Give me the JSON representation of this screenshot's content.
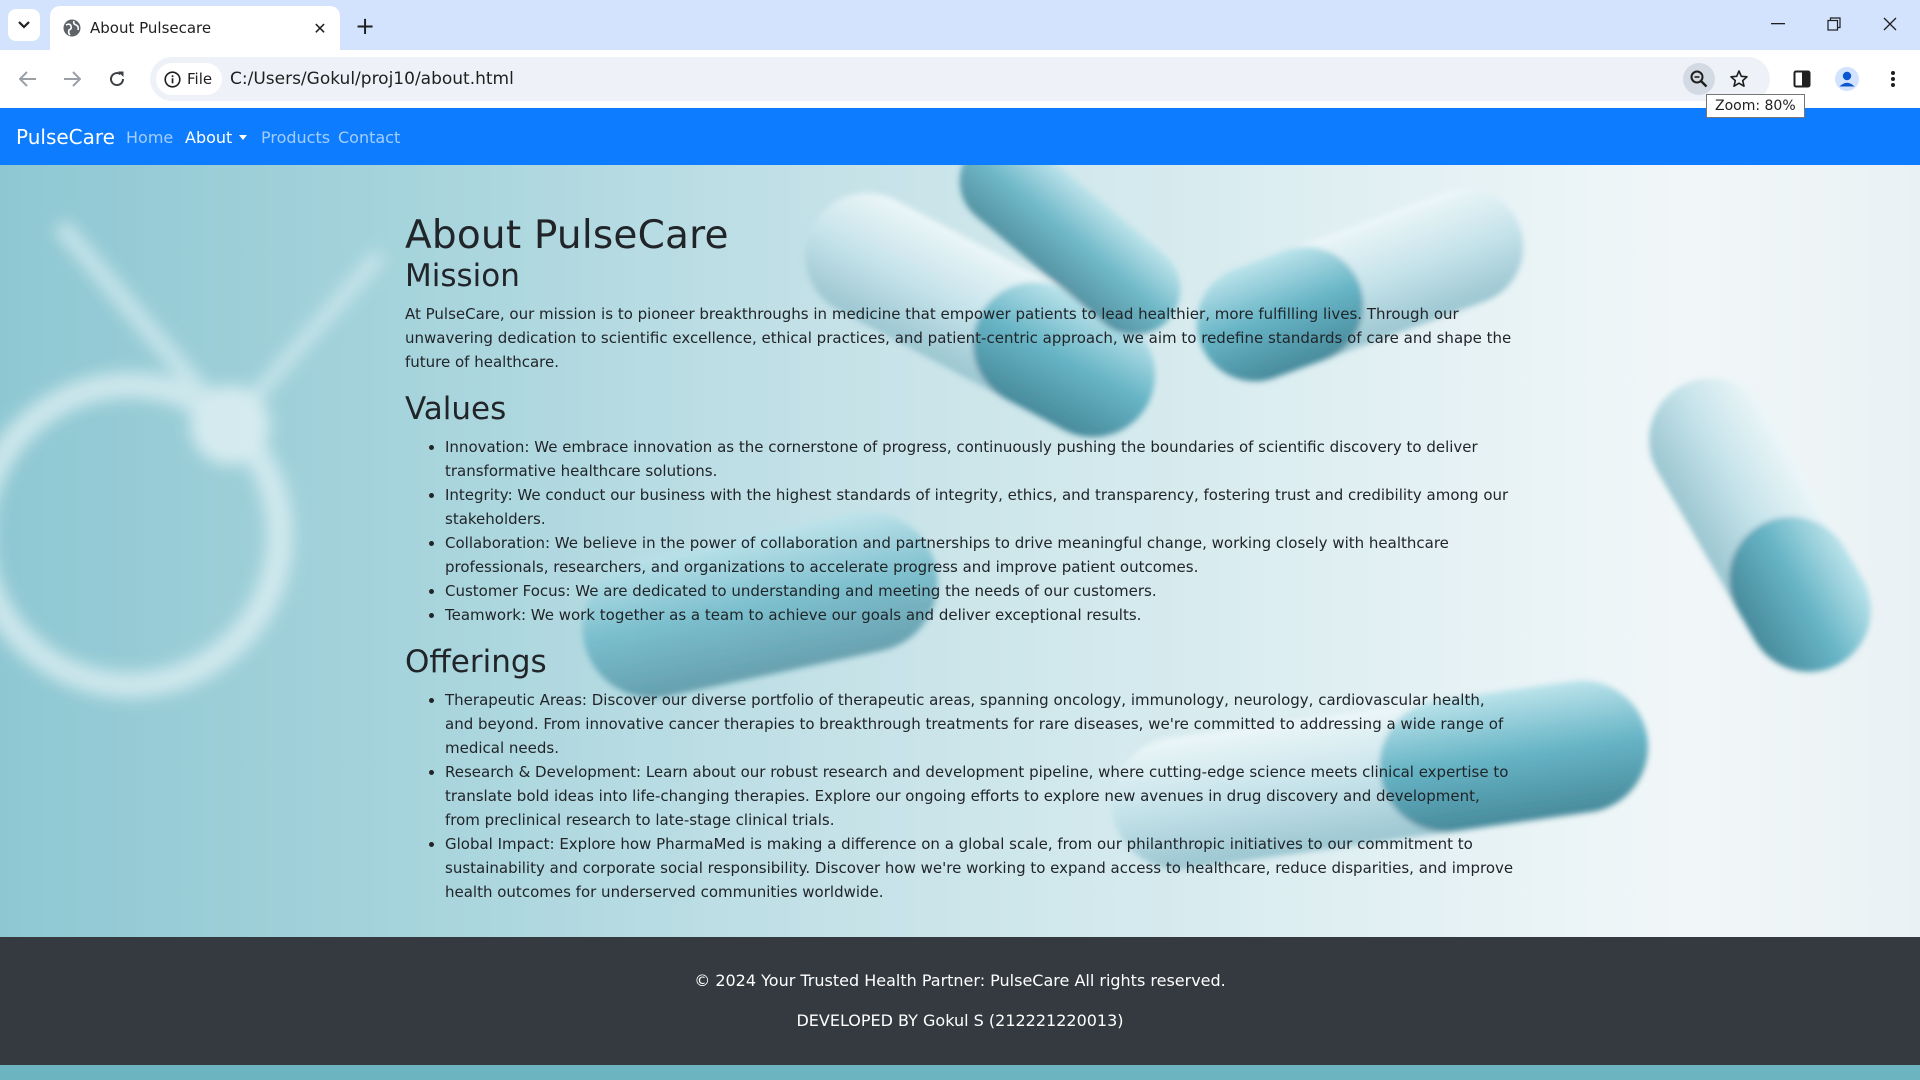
{
  "browser": {
    "tab_title": "About Pulsecare",
    "url_chip": "File",
    "url": "C:/Users/Gokul/proj10/about.html",
    "zoom_tooltip": "Zoom: 80%"
  },
  "navbar": {
    "brand": "PulseCare",
    "links": [
      {
        "label": "Home",
        "active": false
      },
      {
        "label": "About",
        "active": true,
        "dropdown": true
      },
      {
        "label": "Products",
        "active": false
      },
      {
        "label": "Contact",
        "active": false
      }
    ],
    "color": "#0d7cff"
  },
  "main": {
    "title": "About PulseCare",
    "mission": {
      "heading": "Mission",
      "text": "At PulseCare, our mission is to pioneer breakthroughs in medicine that empower patients to lead healthier, more fulfilling lives. Through our unwavering dedication to scientific excellence, ethical practices, and patient-centric approach, we aim to redefine standards of care and shape the future of healthcare."
    },
    "values": {
      "heading": "Values",
      "items": [
        "Innovation: We embrace innovation as the cornerstone of progress, continuously pushing the boundaries of scientific discovery to deliver transformative healthcare solutions.",
        "Integrity: We conduct our business with the highest standards of integrity, ethics, and transparency, fostering trust and credibility among our stakeholders.",
        "Collaboration: We believe in the power of collaboration and partnerships to drive meaningful change, working closely with healthcare professionals, researchers, and organizations to accelerate progress and improve patient outcomes.",
        "Customer Focus: We are dedicated to understanding and meeting the needs of our customers.",
        "Teamwork: We work together as a team to achieve our goals and deliver exceptional results."
      ]
    },
    "offerings": {
      "heading": "Offerings",
      "items": [
        "Therapeutic Areas: Discover our diverse portfolio of therapeutic areas, spanning oncology, immunology, neurology, cardiovascular health, and beyond. From innovative cancer therapies to breakthrough treatments for rare diseases, we're committed to addressing a wide range of medical needs.",
        "Research & Development: Learn about our robust research and development pipeline, where cutting-edge science meets clinical expertise to translate bold ideas into life-changing therapies. Explore our ongoing efforts to explore new avenues in drug discovery and development, from preclinical research to late-stage clinical trials.",
        "Global Impact: Explore how PharmaMed is making a difference on a global scale, from our philanthropic initiatives to our commitment to sustainability and corporate social responsibility. Discover how we're working to expand access to healthcare, reduce disparities, and improve health outcomes for underserved communities worldwide."
      ]
    }
  },
  "footer": {
    "copyright": "© 2024 Your Trusted Health Partner: PulseCare All rights reserved.",
    "developer": "DEVELOPED BY Gokul S (212221220013)",
    "color": "#343a40"
  },
  "icons": [
    "tab-list-icon",
    "globe-icon",
    "close-icon",
    "plus-icon",
    "minimize-icon",
    "restore-icon",
    "window-close-icon",
    "back-icon",
    "forward-icon",
    "reload-icon",
    "info-icon",
    "zoom-icon",
    "star-icon",
    "side-panel-icon",
    "profile-icon",
    "menu-icon"
  ]
}
